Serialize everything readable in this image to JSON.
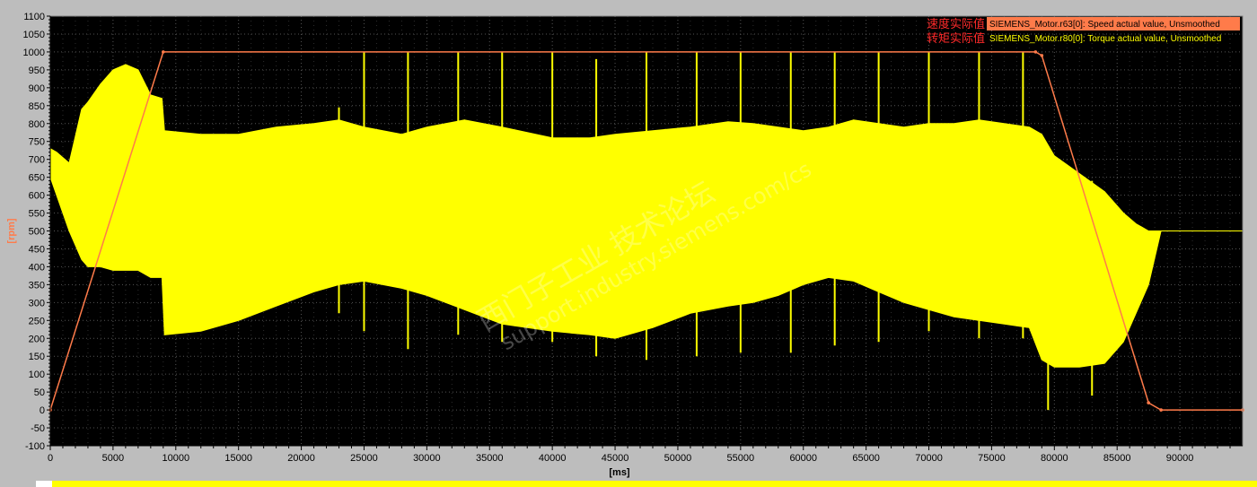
{
  "chart_data": {
    "type": "line",
    "title": "",
    "xlabel": "[ms]",
    "ylabel": "[rpm]",
    "xlim": [
      0,
      95000
    ],
    "ylim": [
      -100,
      1100
    ],
    "x_ticks": [
      0,
      5000,
      10000,
      15000,
      20000,
      25000,
      30000,
      35000,
      40000,
      45000,
      50000,
      55000,
      60000,
      65000,
      70000,
      75000,
      80000,
      85000,
      90000
    ],
    "y_ticks": [
      -100,
      -50,
      0,
      50,
      100,
      150,
      200,
      250,
      300,
      350,
      400,
      450,
      500,
      550,
      600,
      650,
      700,
      750,
      800,
      850,
      900,
      950,
      1000,
      1050,
      1100
    ],
    "grid": true,
    "legend_position": "top-right",
    "legend": [
      {
        "zh": "速度实际值",
        "en": "SIEMENS_Motor.r63[0]: Speed actual value, Unsmoothed",
        "color": "#ff7b4a"
      },
      {
        "zh": "转矩实际值",
        "en": "SIEMENS_Motor.r80[0]: Torque actual value, Unsmoothed",
        "color": "#ffff00"
      }
    ],
    "series": [
      {
        "key": "speed",
        "color": "#ff7b4a",
        "x": [
          0,
          9000,
          78500,
          79000,
          87500,
          88500,
          95000
        ],
        "y": [
          0,
          1000,
          1000,
          990,
          20,
          0,
          0
        ]
      },
      {
        "key": "torque",
        "color": "#ffff00",
        "band": {
          "x": [
            0,
            500,
            1500,
            2500,
            3000,
            4000,
            5000,
            6000,
            7000,
            8000,
            8900,
            9100,
            12000,
            15000,
            18000,
            21000,
            23000,
            25000,
            28000,
            30000,
            33000,
            36000,
            40000,
            43000,
            45000,
            48000,
            51000,
            54000,
            56000,
            58000,
            60000,
            62000,
            64000,
            66000,
            68000,
            70000,
            72000,
            74000,
            76000,
            78000,
            79000,
            80000,
            82000,
            84000,
            85500,
            86500,
            87500,
            88500,
            95000
          ],
          "upper": [
            730,
            720,
            690,
            840,
            860,
            910,
            950,
            965,
            950,
            880,
            870,
            780,
            770,
            770,
            790,
            800,
            810,
            790,
            770,
            790,
            810,
            790,
            760,
            760,
            770,
            780,
            790,
            805,
            800,
            790,
            780,
            790,
            810,
            800,
            790,
            800,
            800,
            810,
            800,
            790,
            770,
            710,
            660,
            610,
            550,
            520,
            500,
            500,
            500
          ],
          "lower": [
            650,
            600,
            500,
            420,
            400,
            400,
            390,
            390,
            390,
            370,
            370,
            210,
            220,
            250,
            290,
            330,
            350,
            360,
            340,
            320,
            280,
            240,
            220,
            210,
            200,
            230,
            270,
            290,
            300,
            320,
            350,
            370,
            360,
            330,
            300,
            280,
            260,
            250,
            240,
            230,
            140,
            120,
            120,
            130,
            190,
            270,
            350,
            500,
            500
          ]
        },
        "spikes": [
          {
            "x": 23000,
            "top": 845,
            "bottom": 270
          },
          {
            "x": 25000,
            "top": 1000,
            "bottom": 220
          },
          {
            "x": 28500,
            "top": 1000,
            "bottom": 170
          },
          {
            "x": 32500,
            "top": 1000,
            "bottom": 210
          },
          {
            "x": 36000,
            "top": 1000,
            "bottom": 190
          },
          {
            "x": 40000,
            "top": 1000,
            "bottom": 190
          },
          {
            "x": 43500,
            "top": 980,
            "bottom": 150
          },
          {
            "x": 47500,
            "top": 1000,
            "bottom": 140
          },
          {
            "x": 51500,
            "top": 1000,
            "bottom": 150
          },
          {
            "x": 55000,
            "top": 1000,
            "bottom": 160
          },
          {
            "x": 59000,
            "top": 1000,
            "bottom": 160
          },
          {
            "x": 62500,
            "top": 1000,
            "bottom": 180
          },
          {
            "x": 66000,
            "top": 1000,
            "bottom": 190
          },
          {
            "x": 70000,
            "top": 1000,
            "bottom": 220
          },
          {
            "x": 74000,
            "top": 1000,
            "bottom": 200
          },
          {
            "x": 77500,
            "top": 1000,
            "bottom": 200
          },
          {
            "x": 79500,
            "top": 700,
            "bottom": 0
          },
          {
            "x": 83000,
            "top": 640,
            "bottom": 40
          }
        ]
      }
    ]
  },
  "watermark": {
    "line1": "西门子工业 技术论坛",
    "line2": "support.industry.siemens.com/cs"
  }
}
